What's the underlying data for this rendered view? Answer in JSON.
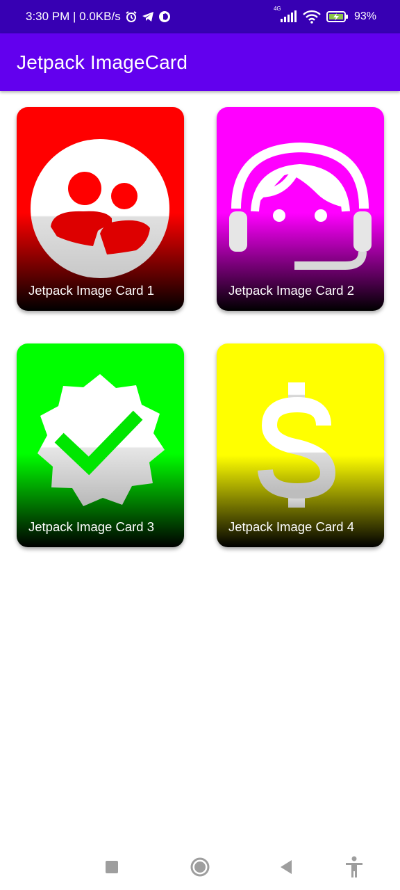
{
  "status_bar": {
    "time_speed": "3:30 PM | 0.0KB/s",
    "network_type": "4G",
    "battery_percent": "93%",
    "icons": [
      "alarm-icon",
      "telegram-icon",
      "sync-icon",
      "signal-icon",
      "wifi-icon",
      "battery-charging-icon"
    ]
  },
  "app_bar": {
    "title": "Jetpack ImageCard",
    "color": "#6200EE"
  },
  "cards": [
    {
      "caption": "Jetpack Image Card 1",
      "color": "#FF0000",
      "icon": "group-chat-icon"
    },
    {
      "caption": "Jetpack Image Card 2",
      "color": "#FF00FF",
      "icon": "headset-support-icon"
    },
    {
      "caption": "Jetpack Image Card 3",
      "color": "#00FF00",
      "icon": "verified-badge-icon"
    },
    {
      "caption": "Jetpack Image Card 4",
      "color": "#FFFF00",
      "icon": "dollar-icon"
    }
  ],
  "nav_bar": {
    "icons": [
      "recents-icon",
      "home-icon",
      "back-icon",
      "accessibility-icon"
    ]
  }
}
